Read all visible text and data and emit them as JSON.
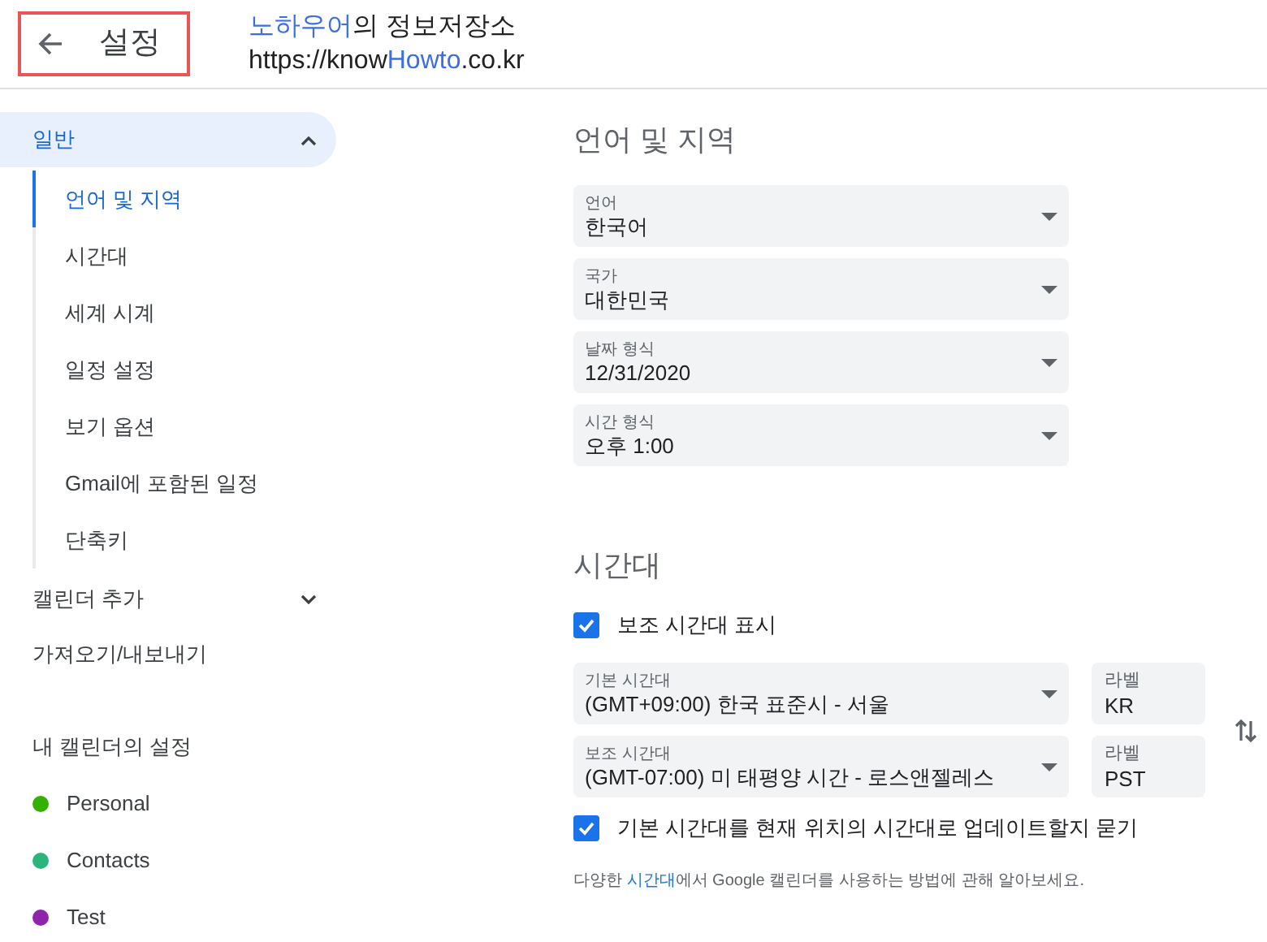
{
  "header": {
    "title": "설정",
    "highlighted": true,
    "site_name": [
      {
        "text": "노하우어",
        "accent": true
      },
      {
        "text": "의 정보저장소",
        "accent": false
      }
    ],
    "site_url": [
      {
        "text": "https://know",
        "accent": false
      },
      {
        "text": "Howto",
        "accent": true
      },
      {
        "text": ".co.kr",
        "accent": false
      }
    ]
  },
  "sidebar": {
    "items": [
      {
        "label": "일반",
        "selected": true,
        "expanded": true,
        "children": [
          {
            "label": "언어 및 지역",
            "selected": true
          },
          {
            "label": "시간대",
            "selected": false
          },
          {
            "label": "세계 시계",
            "selected": false
          },
          {
            "label": "일정 설정",
            "selected": false
          },
          {
            "label": "보기 옵션",
            "selected": false
          },
          {
            "label": "Gmail에 포함된 일정",
            "selected": false
          },
          {
            "label": "단축키",
            "selected": false
          }
        ]
      },
      {
        "label": "캘린더 추가",
        "selected": false,
        "expanded": false
      },
      {
        "label": "가져오기/내보내기",
        "selected": false
      }
    ],
    "calendars_heading": "내 캘린더의 설정",
    "calendars": [
      {
        "name": "Personal",
        "color": "#33b000"
      },
      {
        "name": "Contacts",
        "color": "#2bb57c"
      },
      {
        "name": "Test",
        "color": "#8e24aa"
      }
    ]
  },
  "language_region": {
    "heading": "언어 및 지역",
    "fields": [
      {
        "label": "언어",
        "value": "한국어"
      },
      {
        "label": "국가",
        "value": "대한민국"
      },
      {
        "label": "날짜 형식",
        "value": "12/31/2020"
      },
      {
        "label": "시간 형식",
        "value": "오후 1:00"
      }
    ]
  },
  "time_zone": {
    "heading": "시간대",
    "show_secondary": {
      "label": "보조 시간대 표시",
      "checked": true
    },
    "zones": [
      {
        "label": "기본 시간대",
        "value": "(GMT+09:00) 한국 표준시 - 서울",
        "tag_label": "라벨",
        "tag": "KR"
      },
      {
        "label": "보조 시간대",
        "value": "(GMT-07:00) 미 태평양 시간 - 로스앤젤레스",
        "tag_label": "라벨",
        "tag": "PST"
      }
    ],
    "ask_update": {
      "label": "기본 시간대를 현재 위치의 시간대로 업데이트할지 묻기",
      "checked": true
    },
    "note": [
      {
        "text": "다양한 ",
        "link": false
      },
      {
        "text": "시간대",
        "link": true
      },
      {
        "text": "에서 Google 캘린더를 사용하는 방법에 관해 알아보세요.",
        "link": false
      }
    ]
  }
}
